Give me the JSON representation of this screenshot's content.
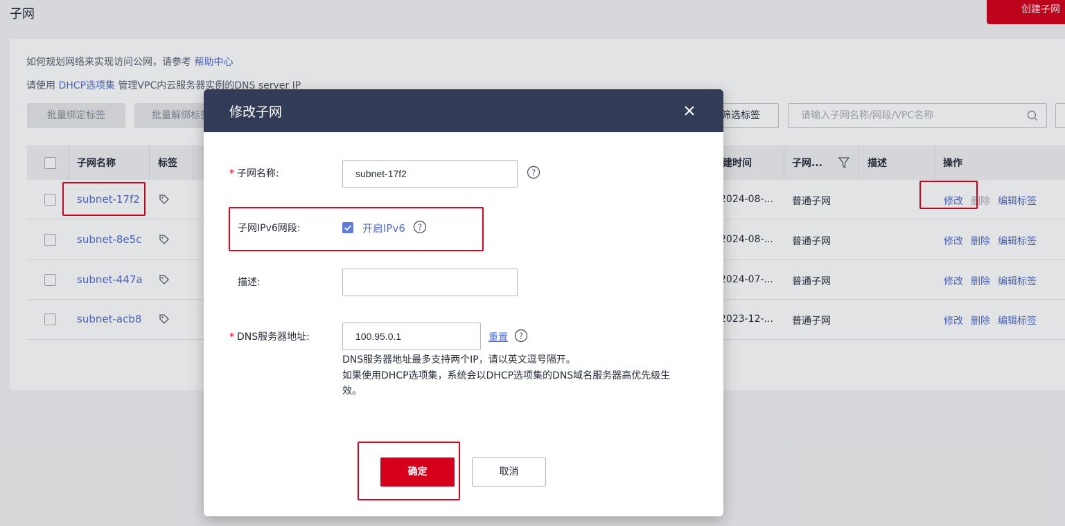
{
  "page": {
    "title": "子网",
    "create_button": "创建子网",
    "help_prefix": "如何规划网络来实现访问公网，请参考",
    "help_link": "帮助中心",
    "dhcp_prefix": "请使用",
    "dhcp_link": "DHCP选项集",
    "dhcp_suffix": "管理VPC内云服务器实例的DNS server IP",
    "batch_bind_tag": "批量绑定标签",
    "batch_unbind_tag": "批量解绑标签",
    "filter_tag": "筛选标签",
    "search_placeholder": "请输入子网名称/网段/VPC名称"
  },
  "table": {
    "headers": {
      "name": "子网名称",
      "tag": "标签",
      "created": "创建时间",
      "type": "子网...",
      "desc": "描述",
      "ops": "操作"
    },
    "rows": [
      {
        "name": "subnet-17f2",
        "created": "2024-08-...",
        "type": "普通子网"
      },
      {
        "name": "subnet-8e5c",
        "created": "2024-08-...",
        "type": "普通子网"
      },
      {
        "name": "subnet-447a",
        "created": "2024-07-...",
        "type": "普通子网"
      },
      {
        "name": "subnet-acb8",
        "created": "2023-12-...",
        "type": "普通子网"
      }
    ],
    "op_edit": "修改",
    "op_delete": "删除",
    "op_edit_tags": "编辑标签"
  },
  "modal": {
    "title": "修改子网",
    "name_label": "子网名称:",
    "name_value": "subnet-17f2",
    "ipv6_label": "子网IPv6网段:",
    "ipv6_checkbox_label": "开启IPv6",
    "ipv6_enabled": true,
    "desc_label": "描述:",
    "desc_value": "",
    "dns_label": "DNS服务器地址:",
    "dns_value": "100.95.0.1",
    "reset_link": "重置",
    "dns_hint_1": "DNS服务器地址最多支持两个IP，请以英文逗号隔开。",
    "dns_hint_2": "如果使用DHCP选项集，系统会以DHCP选项集的DNS域名服务器高优先级生",
    "dns_hint_3": "效。",
    "ok_button": "确定",
    "cancel_button": "取消"
  },
  "colors": {
    "brand_red": "#d6001c",
    "link_blue": "#526ecc",
    "modal_header": "#323c56",
    "highlight_red": "#e3001b"
  }
}
